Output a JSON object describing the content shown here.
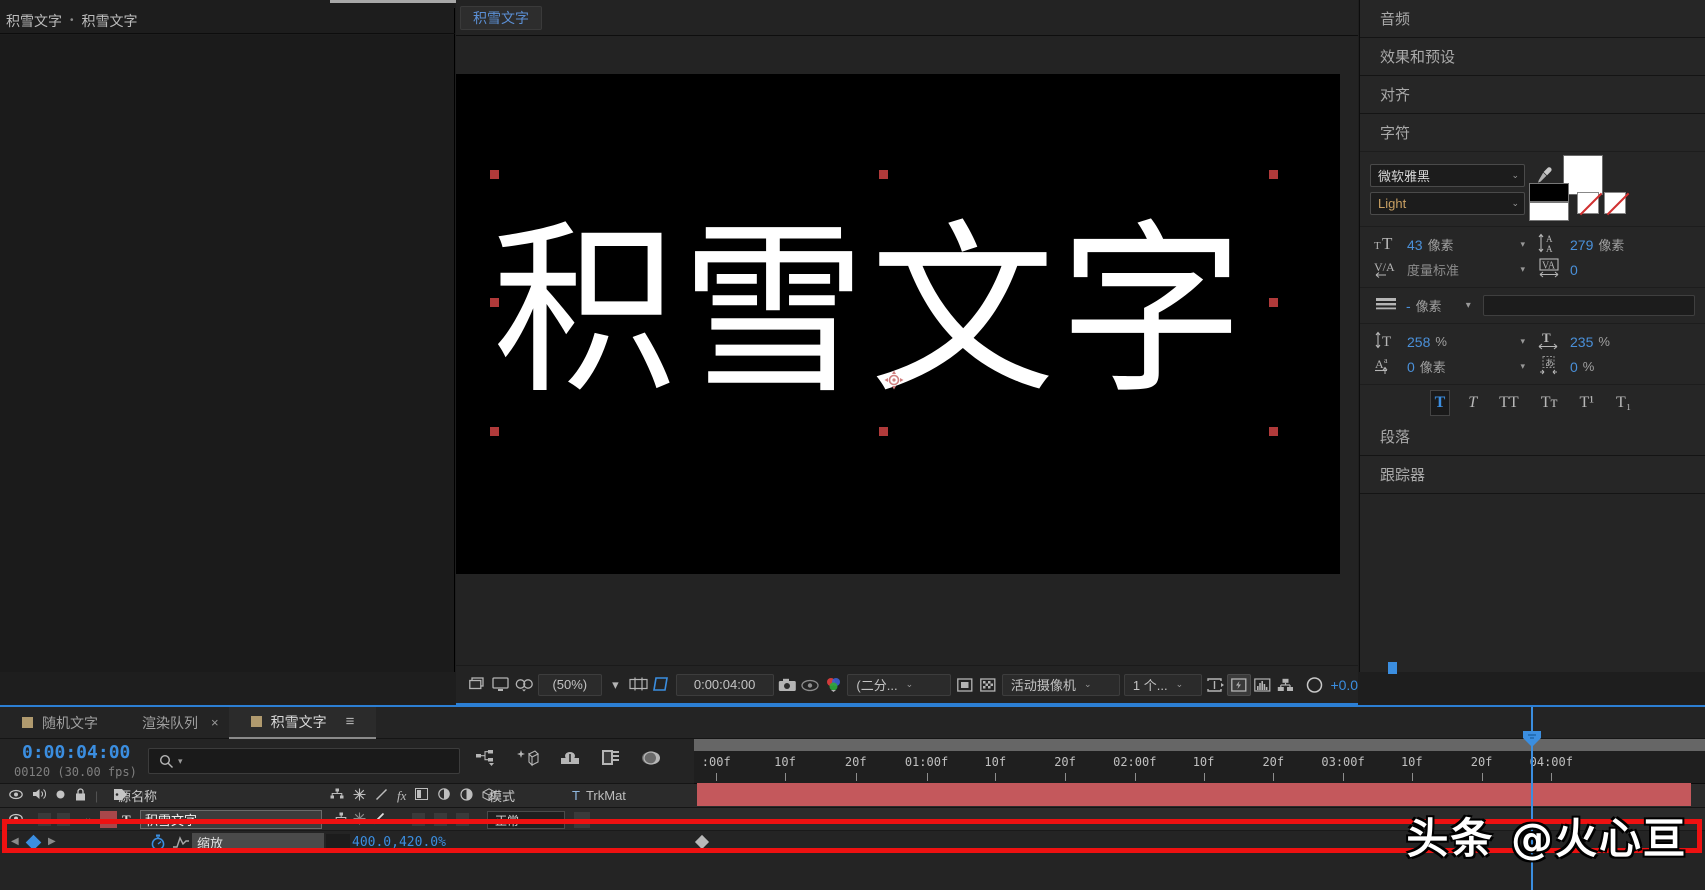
{
  "project": {
    "breadcrumb_root": "积雪文字",
    "breadcrumb_sep": "•",
    "breadcrumb_current": "积雪文字"
  },
  "comp_viewer": {
    "tab_label": "积雪文字",
    "canvas_text": "积雪文字",
    "toolbar": {
      "zoom_level": "(50%)",
      "current_time": "0:00:04:00",
      "resolution": "(二分...",
      "camera": "活动摄像机",
      "view_count": "1 个...",
      "exposure": "+0.0",
      "icons": {
        "take_snapshot": "camera-icon",
        "show_snapshot": "show-snapshot-icon",
        "channel": "channel-icon",
        "region_of_interest": "region-of-interest-icon",
        "transparency_grid": "transparency-grid-icon",
        "mask_visible": "mask-visible-icon",
        "timeline_toggle": "timeline-icon",
        "fast_preview": "fast-preview-icon",
        "histogram": "histogram-icon",
        "comp_flowchart": "flowchart-icon",
        "reset_exposure": "exposure-icon",
        "always_preview": "always-preview-icon",
        "grid_guides": "grid-guides-icon",
        "pixel_aspect": "pixel-aspect-icon"
      }
    }
  },
  "right_panels": {
    "collapsed": [
      {
        "label": "音频",
        "name": "audio"
      },
      {
        "label": "效果和预设",
        "name": "effects-and-presets"
      },
      {
        "label": "对齐",
        "name": "align"
      }
    ],
    "character": {
      "title": "字符",
      "font_family": "微软雅黑",
      "font_style": "Light",
      "font_size": {
        "icon": "font-size-icon",
        "value": "43",
        "unit": "像素"
      },
      "leading": {
        "icon": "leading-icon",
        "value": "279",
        "unit": "像素"
      },
      "kerning": {
        "icon": "kerning-icon",
        "value": "度量标准"
      },
      "tracking": {
        "icon": "tracking-icon",
        "value": "0"
      },
      "stroke_width": {
        "icon": "stroke-width-icon",
        "value": "-",
        "unit": "像素"
      },
      "vertical_scale": {
        "icon": "vertical-scale-icon",
        "value": "258",
        "unit": "%"
      },
      "horizontal_scale": {
        "icon": "horizontal-scale-icon",
        "value": "235",
        "unit": "%"
      },
      "baseline_shift": {
        "icon": "baseline-shift-icon",
        "value": "0",
        "unit": "像素"
      },
      "tsume": {
        "icon": "tsume-icon",
        "value": "0",
        "unit": "%"
      },
      "style_buttons": [
        {
          "label": "T",
          "name": "faux-bold",
          "active": true
        },
        {
          "label": "T",
          "name": "faux-italic",
          "active": false
        },
        {
          "label": "TT",
          "name": "all-caps",
          "active": false
        },
        {
          "label": "Tᴛ",
          "name": "small-caps",
          "active": false
        },
        {
          "label": "T¹",
          "name": "superscript",
          "active": false
        },
        {
          "label": "T₁",
          "name": "subscript",
          "active": false
        }
      ]
    },
    "paragraph_title": "段落",
    "tracker_title": "跟踪器"
  },
  "timeline": {
    "tabs": [
      {
        "label": "随机文字",
        "active": false,
        "has_square": true,
        "closable": false
      },
      {
        "label": "渲染队列",
        "active": false,
        "has_square": false,
        "closable": true
      },
      {
        "label": "积雪文字",
        "active": true,
        "has_square": true,
        "closable": false
      }
    ],
    "current_time": "0:00:04:00",
    "frame_info": "00120 (30.00 fps)",
    "search_placeholder": "",
    "columns": {
      "source_name": "源名称",
      "mode": "模式",
      "trkmat_t": "T",
      "trkmat": "TrkMat"
    },
    "ruler_ticks": [
      {
        "label": ":00f",
        "pos": 0
      },
      {
        "label": "10f",
        "pos": 6.8
      },
      {
        "label": "20f",
        "pos": 13.8
      },
      {
        "label": "01:00f",
        "pos": 20.8
      },
      {
        "label": "10f",
        "pos": 27.6
      },
      {
        "label": "20f",
        "pos": 34.5
      },
      {
        "label": "02:00f",
        "pos": 41.4
      },
      {
        "label": "10f",
        "pos": 48.2
      },
      {
        "label": "20f",
        "pos": 55.1
      },
      {
        "label": "03:00f",
        "pos": 62.0
      },
      {
        "label": "10f",
        "pos": 68.8
      },
      {
        "label": "20f",
        "pos": 75.7
      },
      {
        "label": "04:00f",
        "pos": 82.6
      }
    ],
    "layer": {
      "index_type": "T",
      "name": "积雪文字",
      "mode": "正常",
      "color": "#a8474a"
    },
    "property": {
      "name": "缩放",
      "value": "400.0,420.0%"
    }
  },
  "watermark": "头条 @火心亘",
  "colors": {
    "accent_blue": "#3b8ee0",
    "layer_bar_red": "#c4585c",
    "highlight_red": "#ee1111",
    "panel_bg": "#242424"
  }
}
